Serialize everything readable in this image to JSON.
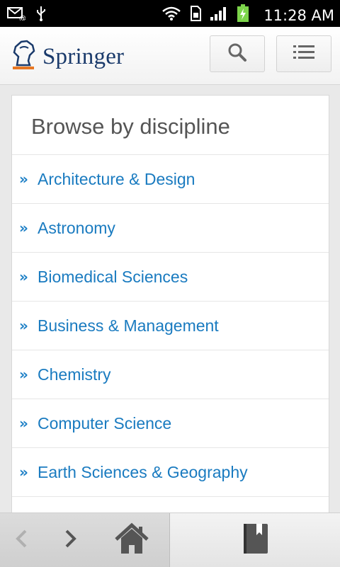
{
  "status_bar": {
    "time": "11:28 AM",
    "icons": [
      "email-notification-icon",
      "usb-icon",
      "wifi-icon",
      "sim-icon",
      "signal-icon",
      "battery-charging-icon"
    ]
  },
  "header": {
    "logo_text": "Springer",
    "icons": [
      "springer-knight-logo",
      "search-icon",
      "menu-icon"
    ]
  },
  "browse": {
    "title": "Browse by discipline",
    "chevron": "»",
    "items": [
      "Architecture & Design",
      "Astronomy",
      "Biomedical Sciences",
      "Business & Management",
      "Chemistry",
      "Computer Science",
      "Earth Sciences & Geography"
    ]
  },
  "bottom_bar": {
    "icons": [
      "back-icon",
      "forward-icon",
      "home-icon",
      "bookmark-icon"
    ]
  },
  "colors": {
    "link": "#1a7bc0",
    "logo_text": "#1a3a6b",
    "logo_accent": "#e87722"
  }
}
